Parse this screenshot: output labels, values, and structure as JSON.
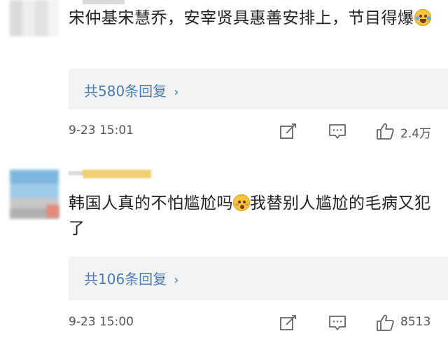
{
  "comments": [
    {
      "text": "宋仲基宋慧乔，安宰贤具惠善安排上，节目得爆",
      "emoji": "laughing-tears-emoji",
      "reply_count_label": "共580条回复",
      "timestamp": "9-23 15:01",
      "like_count": "2.4万"
    },
    {
      "text_before_emoji": "韩国人真的不怕尴尬吗",
      "emoji": "awkward-face-emoji",
      "text_after_emoji": "我替别人尴尬的毛病又犯了",
      "reply_count_label": "共106条回复",
      "timestamp": "9-23 15:00",
      "like_count": "8513"
    }
  ],
  "reply_chevron": "›",
  "colors": {
    "link": "#4a7ab5",
    "reply_bg": "#f3f3f3",
    "meta_text": "#555555",
    "body_text": "#222222"
  },
  "icons": {
    "repost": "repost-icon",
    "comment": "comment-icon",
    "like": "like-icon"
  }
}
